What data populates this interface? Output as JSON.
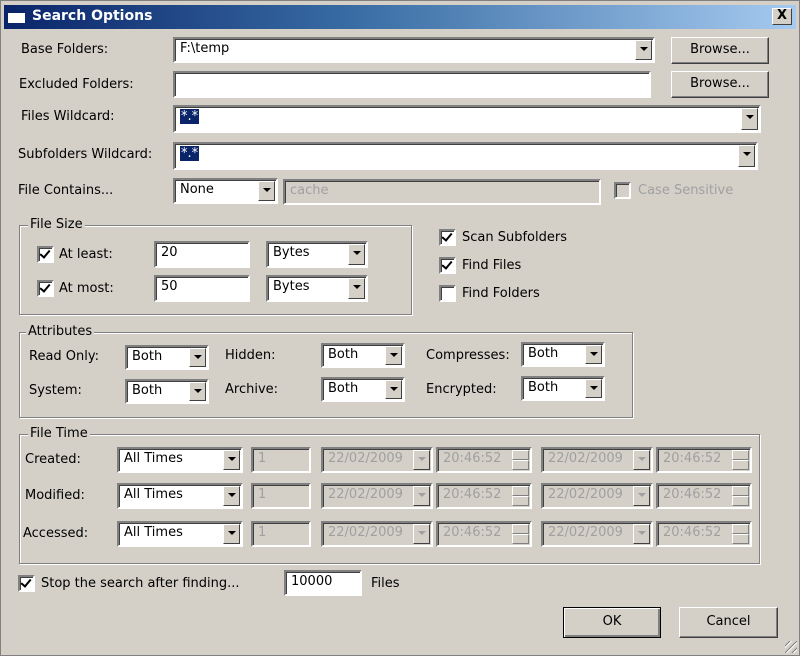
{
  "window": {
    "title": "Search Options",
    "close_label": "X"
  },
  "base_folders": {
    "label": "Base Folders:",
    "value": "F:\\temp",
    "browse_label": "Browse..."
  },
  "excluded_folders": {
    "label": "Excluded Folders:",
    "value": "",
    "browse_label": "Browse..."
  },
  "files_wildcard": {
    "label": "Files Wildcard:",
    "value": "*.*"
  },
  "subfolders_wildcard": {
    "label": "Subfolders Wildcard:",
    "value": "*.*"
  },
  "file_contains": {
    "label": "File Contains...",
    "mode": "None",
    "text": "cache",
    "case_sensitive_label": "Case Sensitive",
    "case_sensitive": false
  },
  "file_size": {
    "title": "File Size",
    "at_least": {
      "label": "At least:",
      "checked": true,
      "value": "20",
      "unit": "Bytes"
    },
    "at_most": {
      "label": "At most:",
      "checked": true,
      "value": "50",
      "unit": "Bytes"
    }
  },
  "options": {
    "scan_subfolders": {
      "label": "Scan Subfolders",
      "checked": true
    },
    "find_files": {
      "label": "Find Files",
      "checked": true
    },
    "find_folders": {
      "label": "Find Folders",
      "checked": false
    }
  },
  "attributes": {
    "title": "Attributes",
    "read_only": {
      "label": "Read Only:",
      "value": "Both"
    },
    "hidden": {
      "label": "Hidden:",
      "value": "Both"
    },
    "compresses": {
      "label": "Compresses:",
      "value": "Both"
    },
    "system": {
      "label": "System:",
      "value": "Both"
    },
    "archive": {
      "label": "Archive:",
      "value": "Both"
    },
    "encrypted": {
      "label": "Encrypted:",
      "value": "Both"
    }
  },
  "file_time": {
    "title": "File Time",
    "rows": [
      {
        "label": "Created:",
        "mode": "All Times",
        "count": "1",
        "from_date": "22/02/2009",
        "from_time": "20:46:52",
        "to_date": "22/02/2009",
        "to_time": "20:46:52"
      },
      {
        "label": "Modified:",
        "mode": "All Times",
        "count": "1",
        "from_date": "22/02/2009",
        "from_time": "20:46:52",
        "to_date": "22/02/2009",
        "to_time": "20:46:52"
      },
      {
        "label": "Accessed:",
        "mode": "All Times",
        "count": "1",
        "from_date": "22/02/2009",
        "from_time": "20:46:52",
        "to_date": "22/02/2009",
        "to_time": "20:46:52"
      }
    ]
  },
  "stop_search": {
    "label": "Stop the search after finding...",
    "checked": true,
    "value": "10000",
    "suffix": "Files"
  },
  "buttons": {
    "ok": "OK",
    "cancel": "Cancel"
  }
}
